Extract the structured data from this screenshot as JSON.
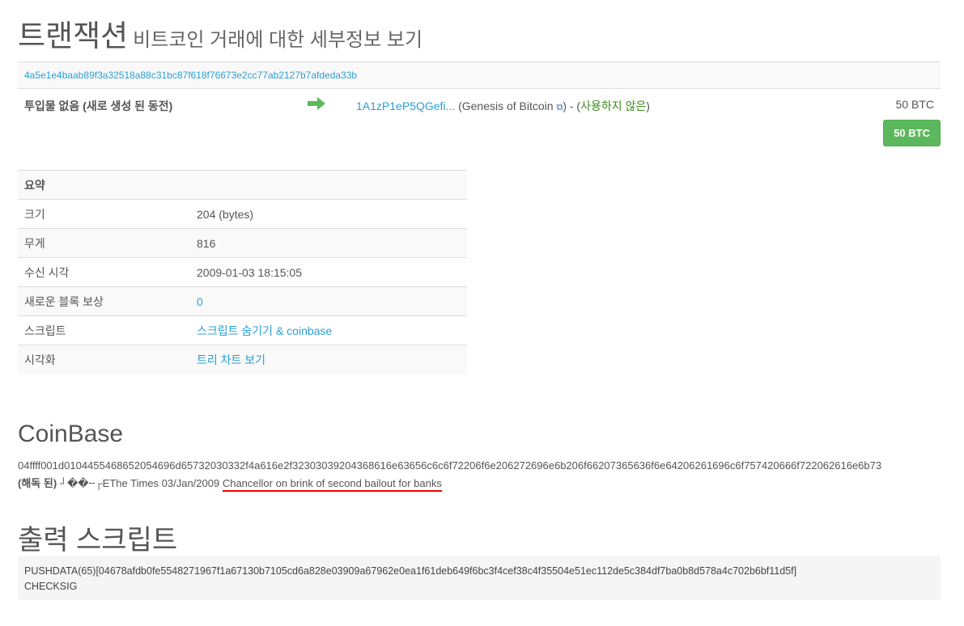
{
  "header": {
    "title": "트랜잭션",
    "subtitle": "비트코인 거래에 대한 세부정보 보기"
  },
  "tx": {
    "hash": "4a5e1e4baab89f3a32518a88c31bc87f618f76673e2cc77ab2127b7afdeda33b",
    "input_label": "투입물 없음 (새로 생성 된 동전)",
    "output_address": "1A1zP1eP5QGefi...",
    "output_tag": "(Genesis of Bitcoin",
    "output_tag_close": ") - (",
    "output_status": "사용하지 않은",
    "output_status_close": ")",
    "output_amount": "50 BTC",
    "total_button": "50 BTC"
  },
  "summary": {
    "header": "요약",
    "rows": [
      {
        "k": "크기",
        "v": "204 (bytes)"
      },
      {
        "k": "무게",
        "v": "816"
      },
      {
        "k": "수신 시각",
        "v": "2009-01-03 18:15:05"
      },
      {
        "k": "새로운 블록 보상",
        "v": "0"
      },
      {
        "k": "스크립트",
        "v": "스크립트 숨기기 & coinbase"
      },
      {
        "k": "시각화",
        "v": "트리 차트 보기"
      }
    ]
  },
  "coinbase": {
    "title": "CoinBase",
    "hex": "04ffff001d0104455468652054696d65732030332f4a616e2f32303039204368616e63656c6c6f72206f6e206272696e6b206f66207365636f6e64206261696c6f757420666f722062616e6b73",
    "decoded_label": "(해독 된)",
    "decoded_prefix": " ┘��╌┌EThe Times 03/Jan/2009 ",
    "decoded_highlight": "Chancellor on brink of second bailout for banks"
  },
  "output_script": {
    "title": "출력 스크립트",
    "line1": "PUSHDATA(65)[04678afdb0fe5548271967f1a67130b7105cd6a828e03909a67962e0ea1f61deb649f6bc3f4cef38c4f35504e51ec112de5c384df7ba0b8d578a4c702b6bf11d5f]",
    "line2": "CHECKSIG"
  }
}
